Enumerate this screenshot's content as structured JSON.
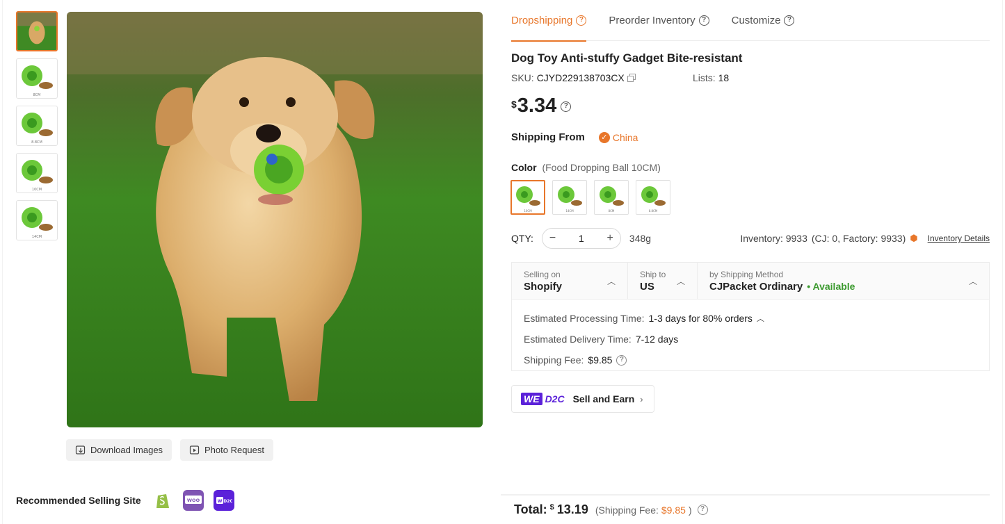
{
  "tabs": [
    {
      "label": "Dropshipping",
      "active": true
    },
    {
      "label": "Preorder Inventory",
      "active": false
    },
    {
      "label": "Customize",
      "active": false
    }
  ],
  "product": {
    "title": "Dog Toy Anti-stuffy Gadget Bite-resistant",
    "sku_label": "SKU:",
    "sku": "CJYD229138703CX",
    "lists_label": "Lists:",
    "lists": "18",
    "price_currency": "$",
    "price": "3.34"
  },
  "shipping_from": {
    "label": "Shipping From",
    "value": "China"
  },
  "color": {
    "label": "Color",
    "selected": "(Food Dropping Ball 10CM)",
    "swatch_count": 4
  },
  "thumb_labels": [
    "8CM",
    "8.8CM",
    "10CM",
    "14CM"
  ],
  "swatch_labels": [
    "10CM",
    "14CM",
    "8CM",
    "8.8CM"
  ],
  "qty": {
    "label": "QTY:",
    "minus": "−",
    "plus": "+",
    "value": "1",
    "weight": "348g"
  },
  "inventory": {
    "text": "Inventory: 9933",
    "detail": "(CJ: 0, Factory: 9933)",
    "link": "Inventory Details"
  },
  "shipping": {
    "selling_on_label": "Selling on",
    "selling_on": "Shopify",
    "ship_to_label": "Ship to",
    "ship_to": "US",
    "method_label": "by Shipping Method",
    "method": "CJPacket Ordinary",
    "availability": "• Available",
    "processing_label": "Estimated Processing Time:",
    "processing": "1-3 days for 80% orders",
    "delivery_label": "Estimated Delivery Time:",
    "delivery": "7-12 days",
    "fee_label": "Shipping Fee:",
    "fee": "$9.85"
  },
  "wed2c": {
    "we": "WE",
    "d2c": "D2C",
    "label": "Sell and Earn"
  },
  "image_buttons": {
    "download": "Download Images",
    "photo": "Photo Request"
  },
  "recommended": {
    "label": "Recommended Selling Site",
    "sites": [
      "shopify-icon",
      "woocommerce-icon",
      "wed2c-icon"
    ]
  },
  "total": {
    "label": "Total:",
    "currency": "$",
    "amount": "13.19",
    "fee_prefix": "(Shipping Fee:",
    "fee": "$9.85",
    "fee_suffix": ")"
  },
  "colors": {
    "accent": "#e8762a",
    "available": "#3c9a2f",
    "wed2c": "#5b21d9"
  }
}
